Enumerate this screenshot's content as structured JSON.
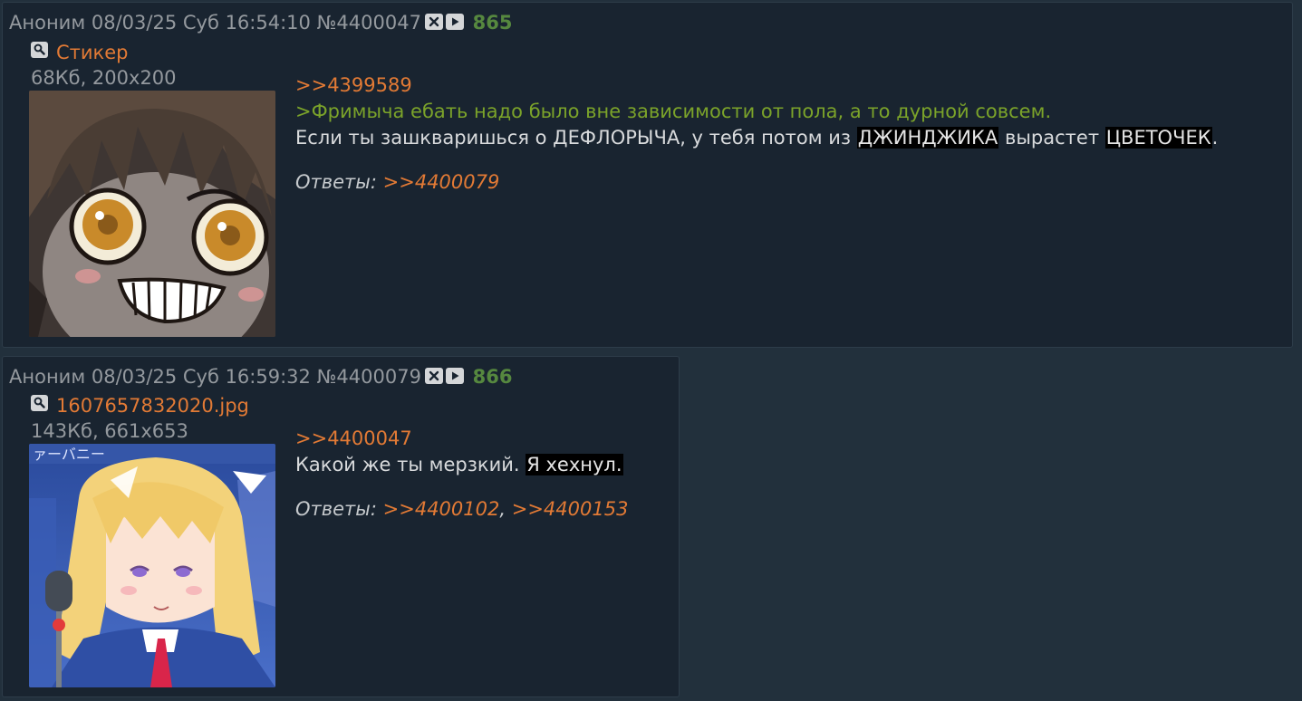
{
  "posts": [
    {
      "author": "Аноним",
      "date": "08/03/25 Суб 16:54:10",
      "number": "№4400047",
      "count": "865",
      "file": {
        "name": "Стикер",
        "meta": "68Кб, 200x200"
      },
      "reply_to": ">>4399589",
      "quote": ">Фримыча ебать надо было вне зависимости от пола, а то дурной совсем.",
      "text_parts": [
        "Если ты зашкваришься о ДЕФЛОРЫЧА, у тебя потом из ",
        "ДЖИНДЖИКА",
        " вырастет ",
        "ЦВЕТОЧЕК",
        "."
      ],
      "replies_label": "Ответы:",
      "replies": [
        ">>4400079"
      ]
    },
    {
      "author": "Аноним",
      "date": "08/03/25 Суб 16:59:32",
      "number": "№4400079",
      "count": "866",
      "file": {
        "name": "1607657832020.jpg",
        "meta": "143Кб, 661x653"
      },
      "reply_to": ">>4400047",
      "text_parts": [
        "Какой же ты мерзкий. ",
        "Я хехнул."
      ],
      "replies_label": "Ответы:",
      "replies": [
        ">>4400102",
        ">>4400153"
      ],
      "replies_sep": ", "
    }
  ],
  "colors": {
    "background": "#22303c",
    "post_bg": "#192430",
    "link": "#e27a35",
    "quote": "#7ba32a",
    "post_count": "#56883f"
  }
}
